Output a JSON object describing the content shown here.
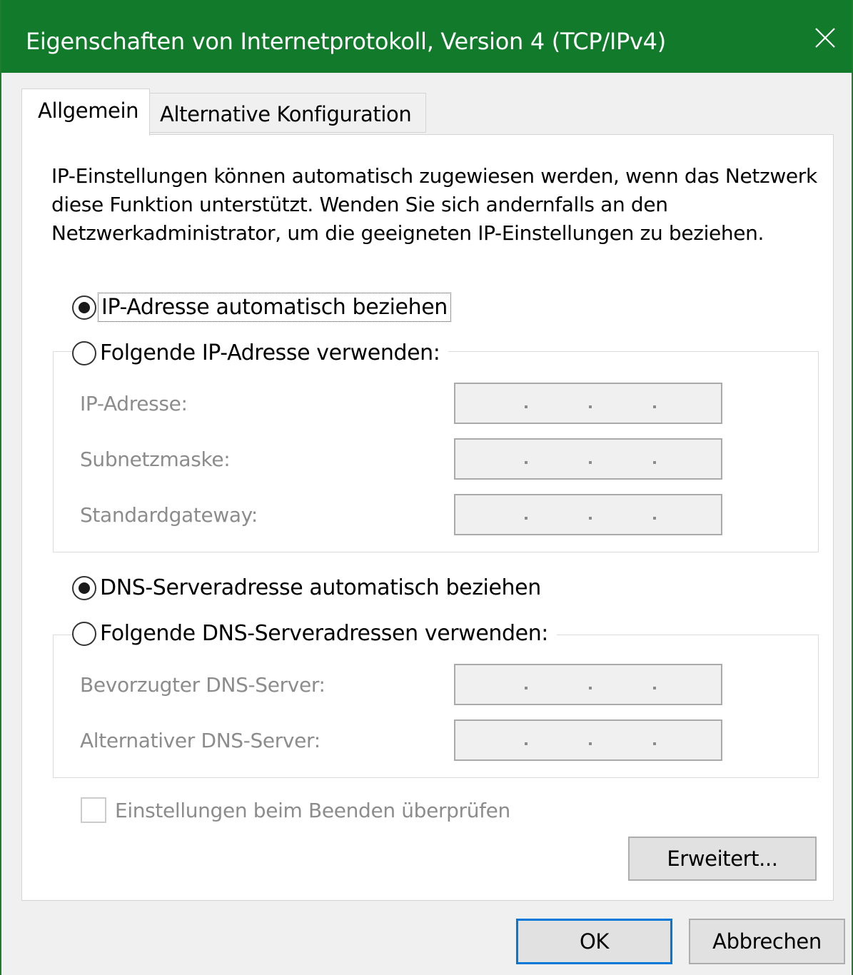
{
  "window": {
    "title": "Eigenschaften von Internetprotokoll, Version 4 (TCP/IPv4)",
    "title_bar_color": "#117a2b"
  },
  "tabs": [
    {
      "label": "Allgemein",
      "selected": true
    },
    {
      "label": "Alternative Konfiguration",
      "selected": false
    }
  ],
  "intro_text": "IP-Einstellungen können automatisch zugewiesen werden, wenn das Netzwerk diese Funktion unterstützt. Wenden Sie sich andernfalls an den Netzwerkadministrator, um die geeigneten IP-Einstellungen zu beziehen.",
  "ip_section": {
    "auto_option": {
      "label": "IP-Adresse automatisch beziehen",
      "checked": true
    },
    "manual_option": {
      "label": "Folgende IP-Adresse verwenden:",
      "checked": false
    },
    "fields": [
      {
        "label": "IP-Adresse:",
        "value": ". . ."
      },
      {
        "label": "Subnetzmaske:",
        "value": ". . ."
      },
      {
        "label": "Standardgateway:",
        "value": ". . ."
      }
    ]
  },
  "dns_section": {
    "auto_option": {
      "label": "DNS-Serveradresse automatisch beziehen",
      "checked": true
    },
    "manual_option": {
      "label": "Folgende DNS-Serveradressen verwenden:",
      "checked": false
    },
    "fields": [
      {
        "label": "Bevorzugter DNS-Server:",
        "value": ". . ."
      },
      {
        "label": "Alternativer DNS-Server:",
        "value": ". . ."
      }
    ]
  },
  "validate_checkbox": {
    "label": "Einstellungen beim Beenden überprüfen",
    "checked": false,
    "enabled": false
  },
  "buttons": {
    "advanced": "Erweitert...",
    "ok": "OK",
    "cancel": "Abbrechen"
  },
  "colors": {
    "accent_focus": "#0078d7",
    "disabled_text": "#8c8c8c"
  }
}
